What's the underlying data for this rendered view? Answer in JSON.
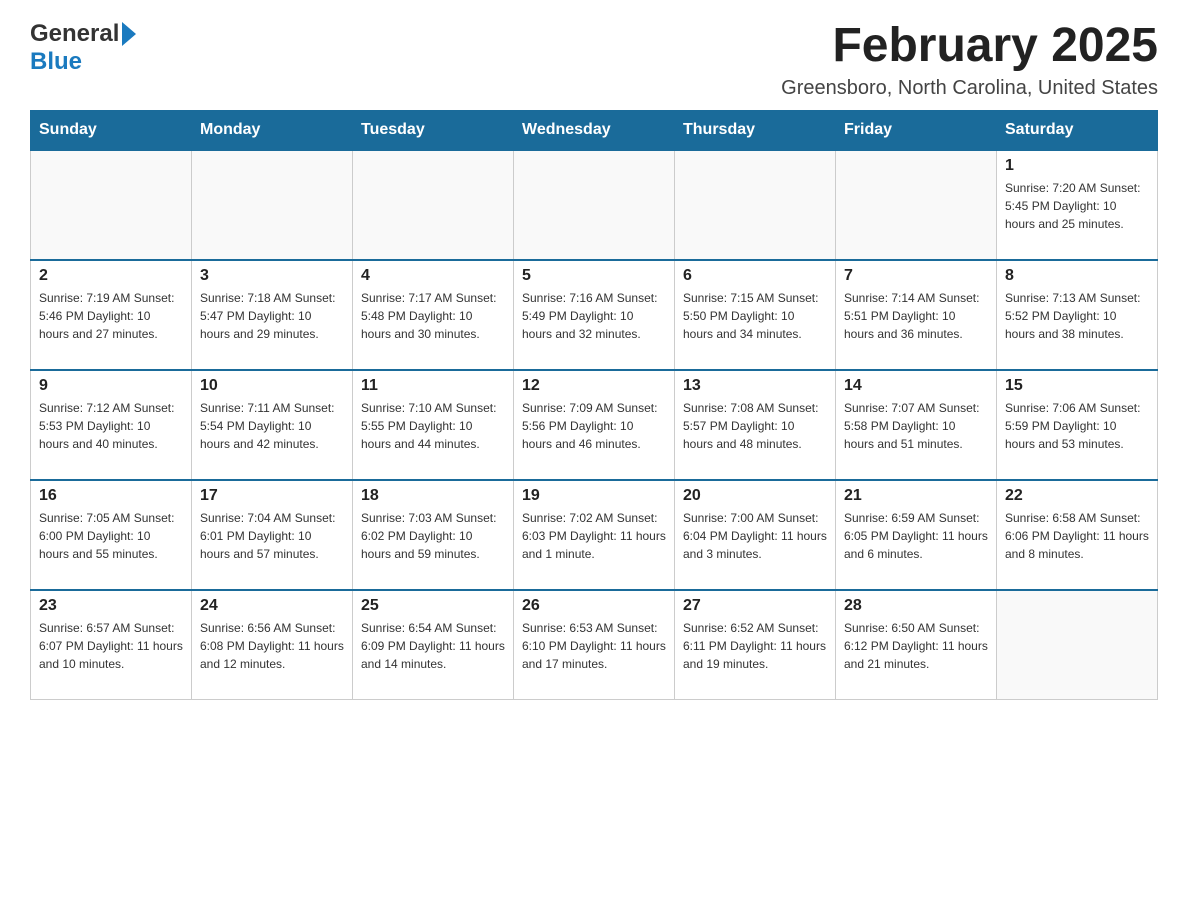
{
  "logo": {
    "general": "General",
    "blue": "Blue"
  },
  "title": "February 2025",
  "location": "Greensboro, North Carolina, United States",
  "days_of_week": [
    "Sunday",
    "Monday",
    "Tuesday",
    "Wednesday",
    "Thursday",
    "Friday",
    "Saturday"
  ],
  "weeks": [
    [
      {
        "day": "",
        "info": ""
      },
      {
        "day": "",
        "info": ""
      },
      {
        "day": "",
        "info": ""
      },
      {
        "day": "",
        "info": ""
      },
      {
        "day": "",
        "info": ""
      },
      {
        "day": "",
        "info": ""
      },
      {
        "day": "1",
        "info": "Sunrise: 7:20 AM\nSunset: 5:45 PM\nDaylight: 10 hours and 25 minutes."
      }
    ],
    [
      {
        "day": "2",
        "info": "Sunrise: 7:19 AM\nSunset: 5:46 PM\nDaylight: 10 hours and 27 minutes."
      },
      {
        "day": "3",
        "info": "Sunrise: 7:18 AM\nSunset: 5:47 PM\nDaylight: 10 hours and 29 minutes."
      },
      {
        "day": "4",
        "info": "Sunrise: 7:17 AM\nSunset: 5:48 PM\nDaylight: 10 hours and 30 minutes."
      },
      {
        "day": "5",
        "info": "Sunrise: 7:16 AM\nSunset: 5:49 PM\nDaylight: 10 hours and 32 minutes."
      },
      {
        "day": "6",
        "info": "Sunrise: 7:15 AM\nSunset: 5:50 PM\nDaylight: 10 hours and 34 minutes."
      },
      {
        "day": "7",
        "info": "Sunrise: 7:14 AM\nSunset: 5:51 PM\nDaylight: 10 hours and 36 minutes."
      },
      {
        "day": "8",
        "info": "Sunrise: 7:13 AM\nSunset: 5:52 PM\nDaylight: 10 hours and 38 minutes."
      }
    ],
    [
      {
        "day": "9",
        "info": "Sunrise: 7:12 AM\nSunset: 5:53 PM\nDaylight: 10 hours and 40 minutes."
      },
      {
        "day": "10",
        "info": "Sunrise: 7:11 AM\nSunset: 5:54 PM\nDaylight: 10 hours and 42 minutes."
      },
      {
        "day": "11",
        "info": "Sunrise: 7:10 AM\nSunset: 5:55 PM\nDaylight: 10 hours and 44 minutes."
      },
      {
        "day": "12",
        "info": "Sunrise: 7:09 AM\nSunset: 5:56 PM\nDaylight: 10 hours and 46 minutes."
      },
      {
        "day": "13",
        "info": "Sunrise: 7:08 AM\nSunset: 5:57 PM\nDaylight: 10 hours and 48 minutes."
      },
      {
        "day": "14",
        "info": "Sunrise: 7:07 AM\nSunset: 5:58 PM\nDaylight: 10 hours and 51 minutes."
      },
      {
        "day": "15",
        "info": "Sunrise: 7:06 AM\nSunset: 5:59 PM\nDaylight: 10 hours and 53 minutes."
      }
    ],
    [
      {
        "day": "16",
        "info": "Sunrise: 7:05 AM\nSunset: 6:00 PM\nDaylight: 10 hours and 55 minutes."
      },
      {
        "day": "17",
        "info": "Sunrise: 7:04 AM\nSunset: 6:01 PM\nDaylight: 10 hours and 57 minutes."
      },
      {
        "day": "18",
        "info": "Sunrise: 7:03 AM\nSunset: 6:02 PM\nDaylight: 10 hours and 59 minutes."
      },
      {
        "day": "19",
        "info": "Sunrise: 7:02 AM\nSunset: 6:03 PM\nDaylight: 11 hours and 1 minute."
      },
      {
        "day": "20",
        "info": "Sunrise: 7:00 AM\nSunset: 6:04 PM\nDaylight: 11 hours and 3 minutes."
      },
      {
        "day": "21",
        "info": "Sunrise: 6:59 AM\nSunset: 6:05 PM\nDaylight: 11 hours and 6 minutes."
      },
      {
        "day": "22",
        "info": "Sunrise: 6:58 AM\nSunset: 6:06 PM\nDaylight: 11 hours and 8 minutes."
      }
    ],
    [
      {
        "day": "23",
        "info": "Sunrise: 6:57 AM\nSunset: 6:07 PM\nDaylight: 11 hours and 10 minutes."
      },
      {
        "day": "24",
        "info": "Sunrise: 6:56 AM\nSunset: 6:08 PM\nDaylight: 11 hours and 12 minutes."
      },
      {
        "day": "25",
        "info": "Sunrise: 6:54 AM\nSunset: 6:09 PM\nDaylight: 11 hours and 14 minutes."
      },
      {
        "day": "26",
        "info": "Sunrise: 6:53 AM\nSunset: 6:10 PM\nDaylight: 11 hours and 17 minutes."
      },
      {
        "day": "27",
        "info": "Sunrise: 6:52 AM\nSunset: 6:11 PM\nDaylight: 11 hours and 19 minutes."
      },
      {
        "day": "28",
        "info": "Sunrise: 6:50 AM\nSunset: 6:12 PM\nDaylight: 11 hours and 21 minutes."
      },
      {
        "day": "",
        "info": ""
      }
    ]
  ]
}
